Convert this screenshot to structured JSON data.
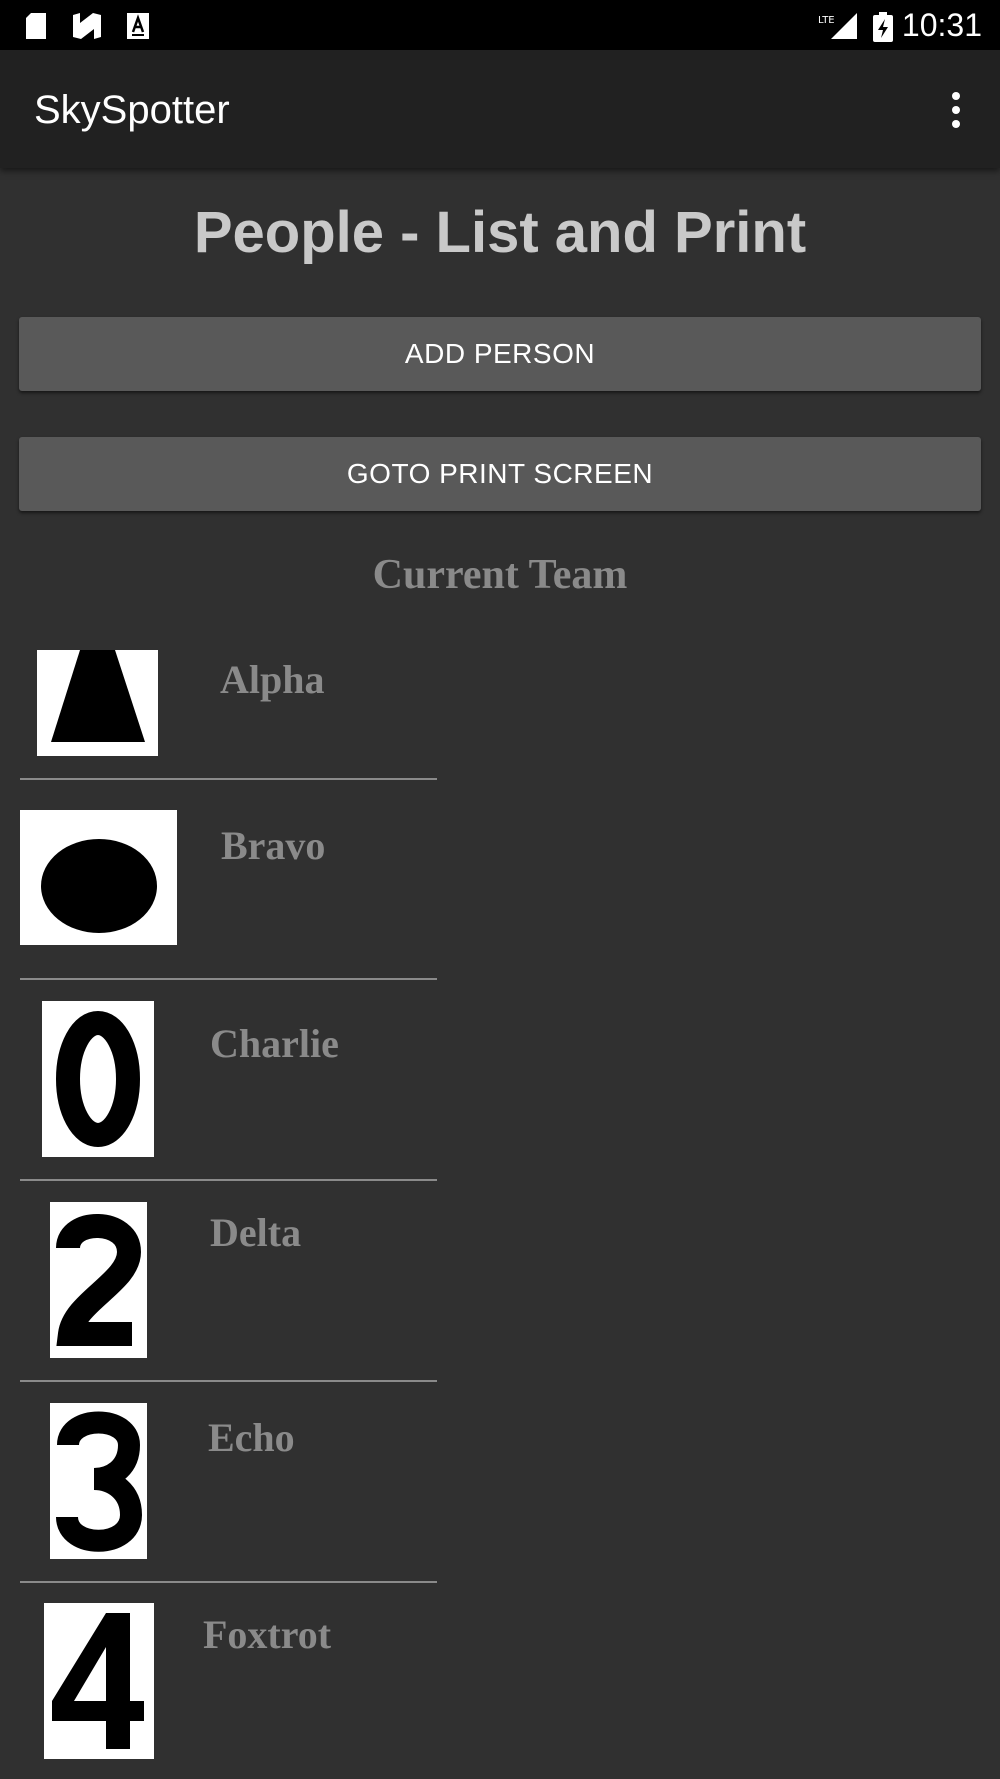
{
  "status_bar": {
    "time": "10:31",
    "icons": [
      "sd-card-icon",
      "n-notification-icon",
      "a-notification-icon",
      "lte-signal-icon",
      "battery-charging-icon"
    ]
  },
  "app_bar": {
    "title": "SkySpotter",
    "menu_icon": "overflow-menu-icon"
  },
  "page": {
    "title": "People - List and Print",
    "add_button": "ADD PERSON",
    "print_button": "GOTO PRINT SCREEN",
    "section_title": "Current Team"
  },
  "team": [
    {
      "name": "Alpha",
      "icon": "trapezoid-icon"
    },
    {
      "name": "Bravo",
      "icon": "ellipse-icon"
    },
    {
      "name": "Charlie",
      "icon": "digit-0-icon"
    },
    {
      "name": "Delta",
      "icon": "digit-2-icon"
    },
    {
      "name": "Echo",
      "icon": "digit-3-icon"
    },
    {
      "name": "Foxtrot",
      "icon": "digit-4-icon"
    }
  ]
}
